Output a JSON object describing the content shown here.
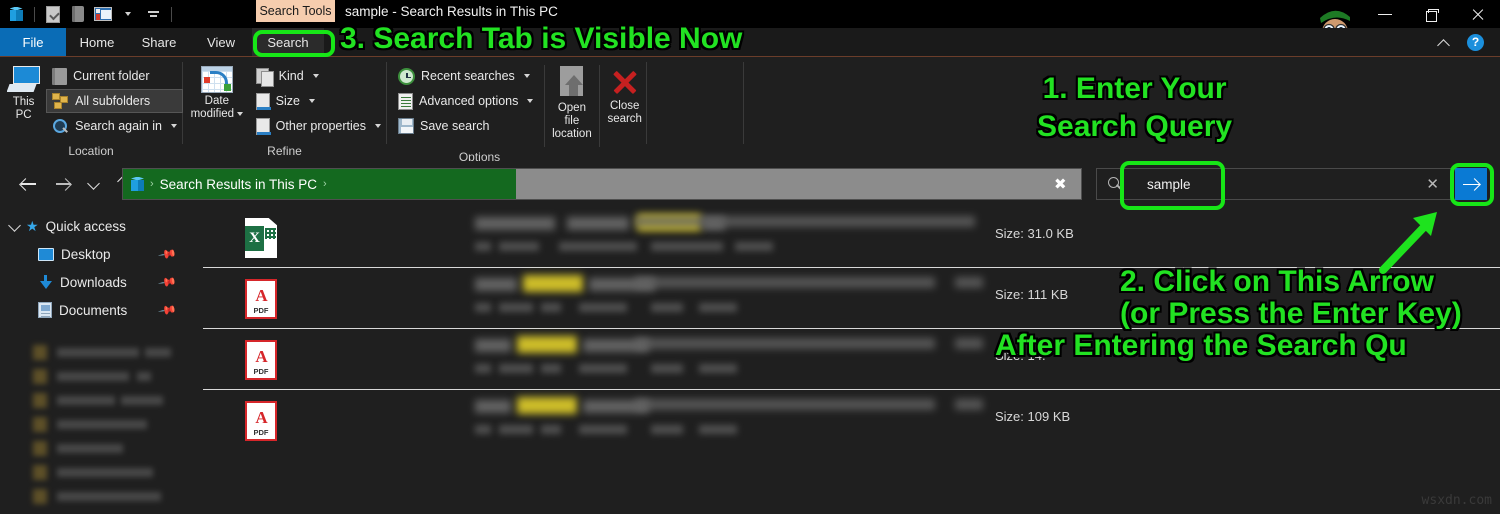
{
  "window": {
    "title": "sample - Search Results in This PC",
    "contextual_tab": "Search Tools",
    "quick_access_icons": [
      "this-pc-icon",
      "properties-icon",
      "new-folder-icon",
      "view-icon",
      "customize-dropdown-icon"
    ],
    "controls": {
      "minimize": "minimize",
      "maximize": "maximize",
      "close": "close",
      "collapse_ribbon": "chevron-up",
      "help": "?"
    }
  },
  "tabs": [
    {
      "label": "File",
      "name": "tab-file"
    },
    {
      "label": "Home",
      "name": "tab-home"
    },
    {
      "label": "Share",
      "name": "tab-share"
    },
    {
      "label": "View",
      "name": "tab-view"
    },
    {
      "label": "Search",
      "name": "tab-search"
    }
  ],
  "ribbon": {
    "groups": [
      {
        "caption": "Location",
        "big_button": {
          "line1": "This",
          "line2": "PC",
          "icon": "this-pc-icon"
        },
        "items": [
          {
            "label": "Current folder",
            "icon": "folder-icon",
            "dropdown": false,
            "selected": false
          },
          {
            "label": "All subfolders",
            "icon": "subfolders-icon",
            "dropdown": false,
            "selected": true
          },
          {
            "label": "Search again in",
            "icon": "magnifier-icon",
            "dropdown": true,
            "selected": false
          }
        ]
      },
      {
        "caption": "Refine",
        "big_button": {
          "line1": "Date",
          "line2": "modified",
          "icon": "calendar-icon",
          "dropdown": true
        },
        "items": [
          {
            "label": "Kind",
            "icon": "kind-icon",
            "dropdown": true
          },
          {
            "label": "Size",
            "icon": "size-icon",
            "dropdown": true
          },
          {
            "label": "Other properties",
            "icon": "properties-icon",
            "dropdown": true
          }
        ]
      },
      {
        "caption": "Options",
        "items": [
          {
            "label": "Recent searches",
            "icon": "recent-searches-icon",
            "dropdown": true
          },
          {
            "label": "Advanced options",
            "icon": "advanced-options-icon",
            "dropdown": true
          },
          {
            "label": "Save search",
            "icon": "save-search-icon",
            "dropdown": false
          }
        ],
        "big_buttons": [
          {
            "line1": "Open file",
            "line2": "location",
            "icon": "open-file-location-icon"
          },
          {
            "line1": "Close",
            "line2": "search",
            "icon": "close-search-icon"
          }
        ]
      }
    ]
  },
  "address_bar": {
    "breadcrumb_icon": "this-pc-icon",
    "path": "Search Results in This PC",
    "separator": "›",
    "clear_label": "✖"
  },
  "search": {
    "value": "sample",
    "icon": "search-icon",
    "clear": "✕",
    "go": "go-arrow"
  },
  "nav_pane": {
    "root": {
      "label": "Quick access",
      "icon": "star-icon"
    },
    "items": [
      {
        "label": "Desktop",
        "icon": "desktop-icon",
        "pinned": true
      },
      {
        "label": "Downloads",
        "icon": "downloads-icon",
        "pinned": true
      },
      {
        "label": "Documents",
        "icon": "documents-icon",
        "pinned": true
      }
    ],
    "blurred_item_count": 7
  },
  "results": {
    "rows": [
      {
        "icon": "excel-file-icon",
        "size_label": "Size: 31.0 KB",
        "name_redacted": true
      },
      {
        "icon": "pdf-file-icon",
        "size_label": "Size: 111 KB",
        "name_redacted": true
      },
      {
        "icon": "pdf-file-icon",
        "size_label": "Size: 14.",
        "name_redacted": true
      },
      {
        "icon": "pdf-file-icon",
        "size_label": "Size: 109 KB",
        "name_redacted": true
      }
    ]
  },
  "annotations": {
    "step3": "3. Search Tab is Visible Now",
    "step1_line1": "1. Enter Your",
    "step1_line2": "Search Query",
    "step2_line1": "2. Click on This Arrow",
    "step2_line2": "(or Press the Enter Key)",
    "step2_line3": "After Entering the Search Qu",
    "arrow": "green-arrow-pointing-up-right",
    "color": "#22e222"
  },
  "watermark": "wsxdn.com"
}
